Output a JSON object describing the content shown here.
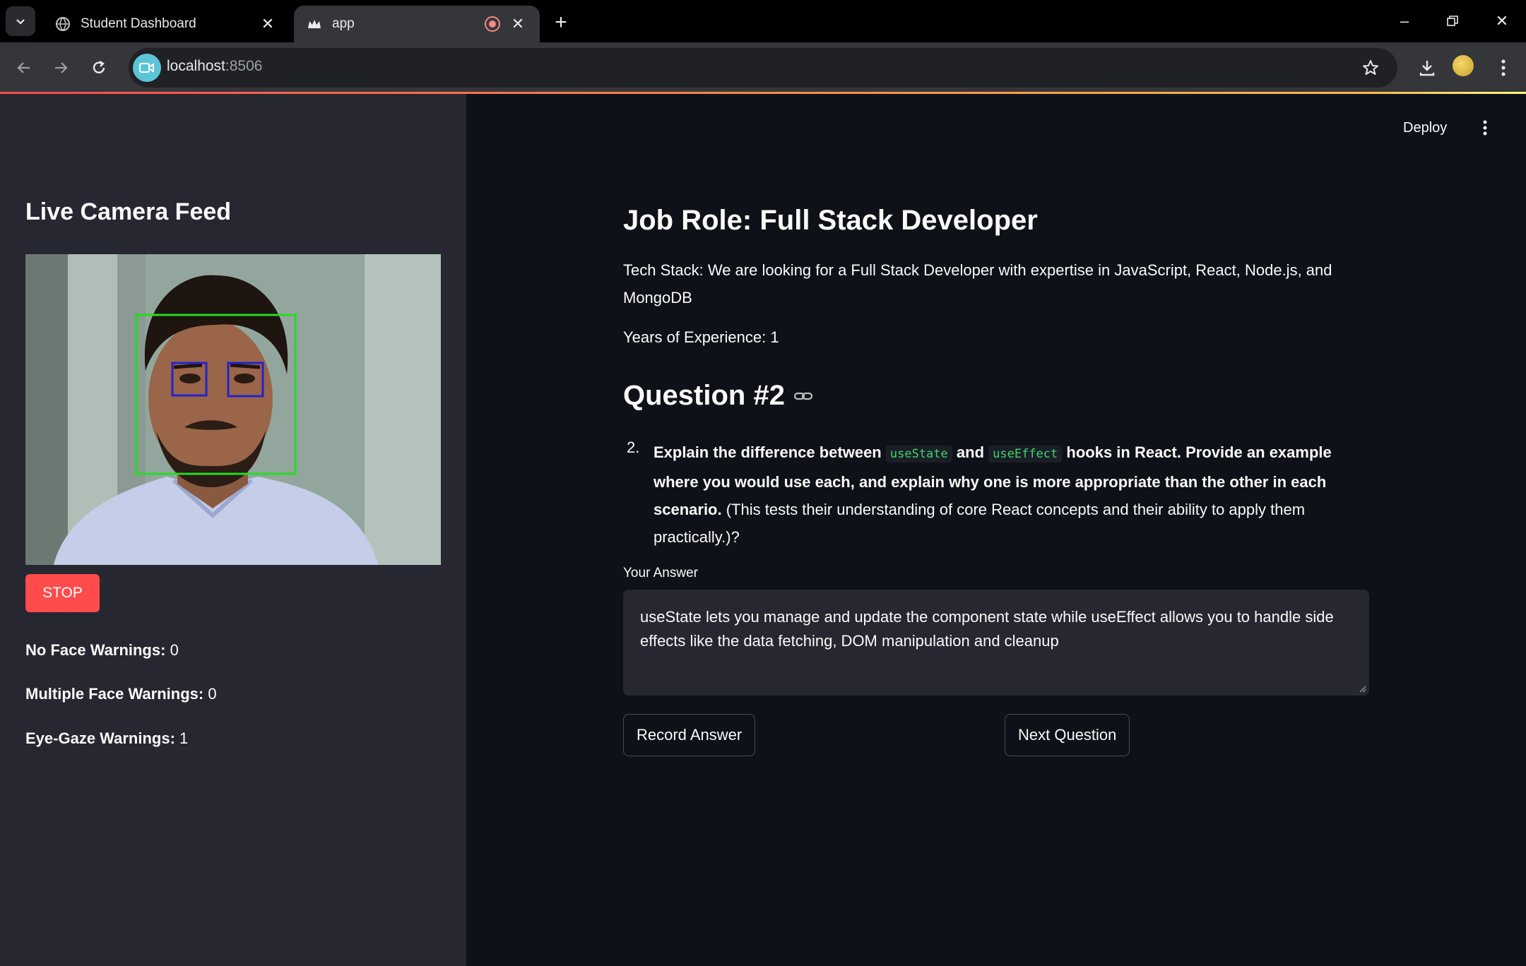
{
  "browser": {
    "tabs": [
      {
        "title": "Student Dashboard",
        "active": false
      },
      {
        "title": "app",
        "active": true
      }
    ],
    "url_host": "localhost",
    "url_port": ":8506"
  },
  "sidebar": {
    "title": "Live Camera Feed",
    "stop_label": "STOP",
    "warnings": [
      {
        "label": "No Face Warnings:",
        "value": "0"
      },
      {
        "label": "Multiple Face Warnings:",
        "value": "0"
      },
      {
        "label": "Eye-Gaze Warnings:",
        "value": "1"
      }
    ]
  },
  "header": {
    "deploy_label": "Deploy"
  },
  "main": {
    "title": "Job Role: Full Stack Developer",
    "tech_stack": "Tech Stack: We are looking for a Full Stack Developer with expertise in JavaScript, React, Node.js, and MongoDB",
    "years": "Years of Experience: 1",
    "question_heading": "Question #2",
    "question_number": "2.",
    "question_parts": {
      "bold_1": "Explain the difference between",
      "code_1": "useState",
      "bold_2": "and",
      "code_2": "useEffect",
      "bold_3": "hooks in React. Provide an example where you would use each, and explain why one is more appropriate than the other in each scenario.",
      "plain": "(This tests their understanding of core React concepts and their ability to apply them practically.)?"
    },
    "answer_label": "Your Answer",
    "answer_value": "useState lets you manage and update the component state while useEffect allows you to handle side effects like the data fetching, DOM manipulation and cleanup",
    "record_label": "Record Answer",
    "next_label": "Next Question"
  },
  "colors": {
    "app_bg": "#0e1117",
    "sidebar_bg": "#262730",
    "primary": "#ff4b4b",
    "code_green": "#3dd56d",
    "face_box": "#22dd22",
    "eye_box": "#2222cc"
  },
  "icons": [
    "tab-search-icon",
    "globe-icon",
    "streamlit-crown-icon",
    "recording-icon",
    "close-icon",
    "plus-icon",
    "minimize-icon",
    "restore-icon",
    "back-icon",
    "forward-icon",
    "reload-icon",
    "video-camera-icon",
    "star-icon",
    "download-icon",
    "kebab-icon",
    "link-icon"
  ]
}
